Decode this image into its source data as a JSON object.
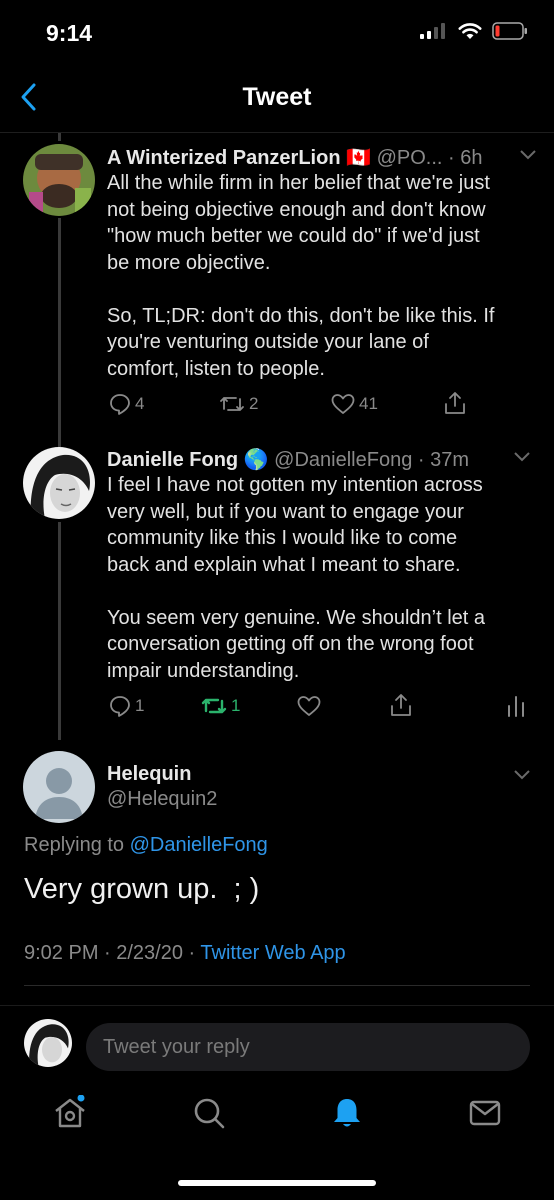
{
  "status": {
    "time": "9:14"
  },
  "header": {
    "title": "Tweet"
  },
  "tweets": [
    {
      "name": "A Winterized PanzerLion",
      "flag": "🇨🇦",
      "handle": "@PO...",
      "time": "· 6h",
      "lines": [
        "All the while firm in her belief that we're just",
        "not being objective enough and don't know",
        "\"how much better we could do\" if we'd just",
        "be more objective.",
        "",
        "So, TL;DR: don't do this, don't be like this. If",
        "you're venturing outside your lane of",
        "comfort, listen to people."
      ],
      "replies": "4",
      "retweets": "2",
      "likes": "41"
    },
    {
      "name": "Danielle Fong",
      "flag": "🌎",
      "handle": "@DanielleFong",
      "time": "· 37m",
      "lines": [
        "I feel I have not gotten my intention across",
        "very well, but if you want to engage your",
        "community like this I would like to come",
        "back and explain what I meant to share.",
        "",
        "You seem very genuine. We shouldn’t let a",
        "conversation getting off on the wrong foot",
        "impair understanding."
      ],
      "replies": "1",
      "retweets": "1",
      "likes": ""
    }
  ],
  "main": {
    "name": "Helequin",
    "handle": "@Helequin2",
    "replying_prefix": "Replying to",
    "replying_to": "@DanielleFong",
    "text": "Very grown up.  ; )",
    "datetime": "9:02 PM · 2/23/20 ·",
    "source": "Twitter Web App"
  },
  "compose": {
    "placeholder": "Tweet your reply"
  },
  "colors": {
    "accent": "#1da1f2",
    "retweet_active": "#17bf63",
    "background": "#000000"
  }
}
